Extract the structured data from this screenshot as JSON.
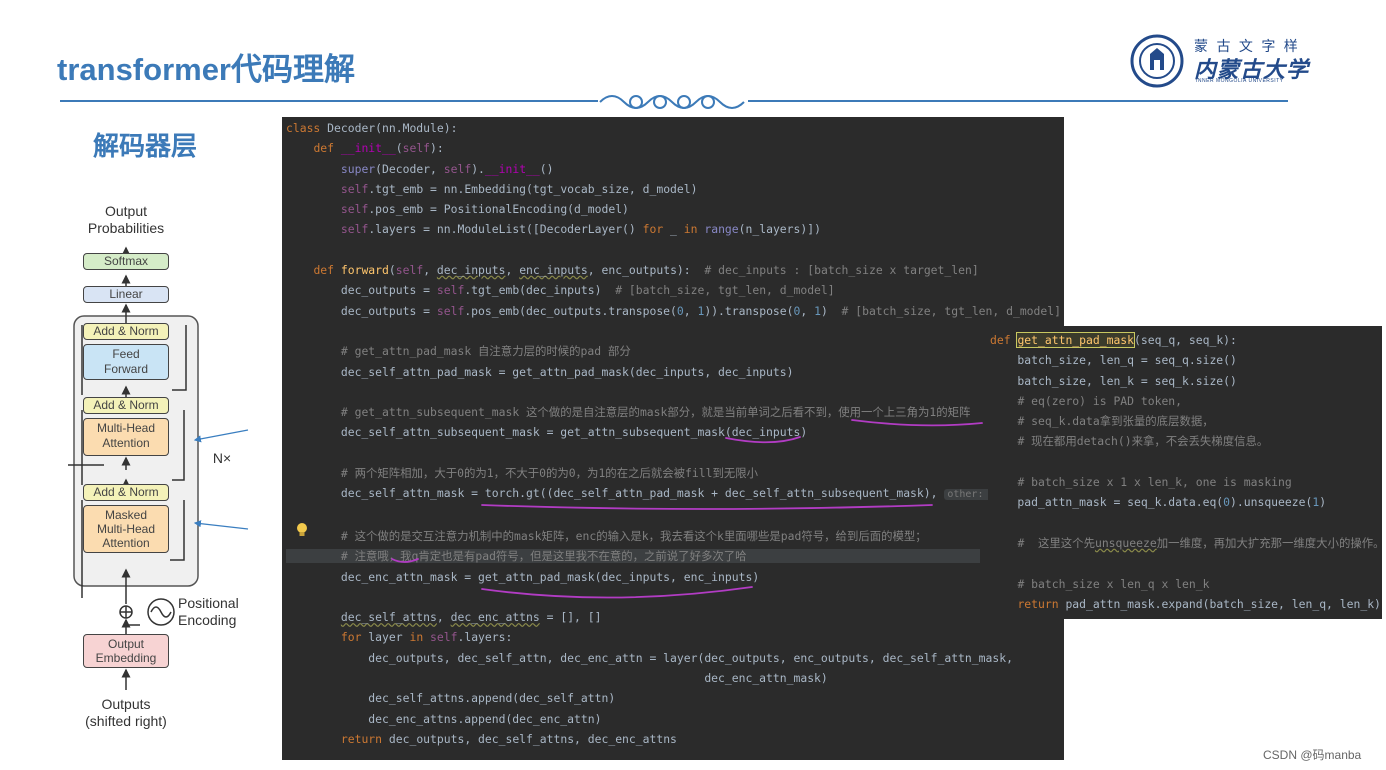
{
  "slide": {
    "title": "transformer代码理解",
    "section_title": "解码器层",
    "watermark": "CSDN @码manba"
  },
  "logo": {
    "name_cn_small": "蒙 古 文 字 样",
    "name_cn": "内蒙古大学",
    "name_en": "INNER MONGOLIA UNIVERSITY"
  },
  "diagram": {
    "output_label": "Output\nProbabilities",
    "softmax": "Softmax",
    "linear": "Linear",
    "add_norm": "Add & Norm",
    "feed_forward": "Feed\nForward",
    "multi_head": "Multi-Head\nAttention",
    "masked_multi_head": "Masked\nMulti-Head\nAttention",
    "nx": "N×",
    "positional": "Positional\nEncoding",
    "output_embedding": "Output\nEmbedding",
    "outputs_label": "Outputs\n(shifted right)"
  },
  "code_main": {
    "hint_other": "other: 0"
  },
  "code_side": {}
}
